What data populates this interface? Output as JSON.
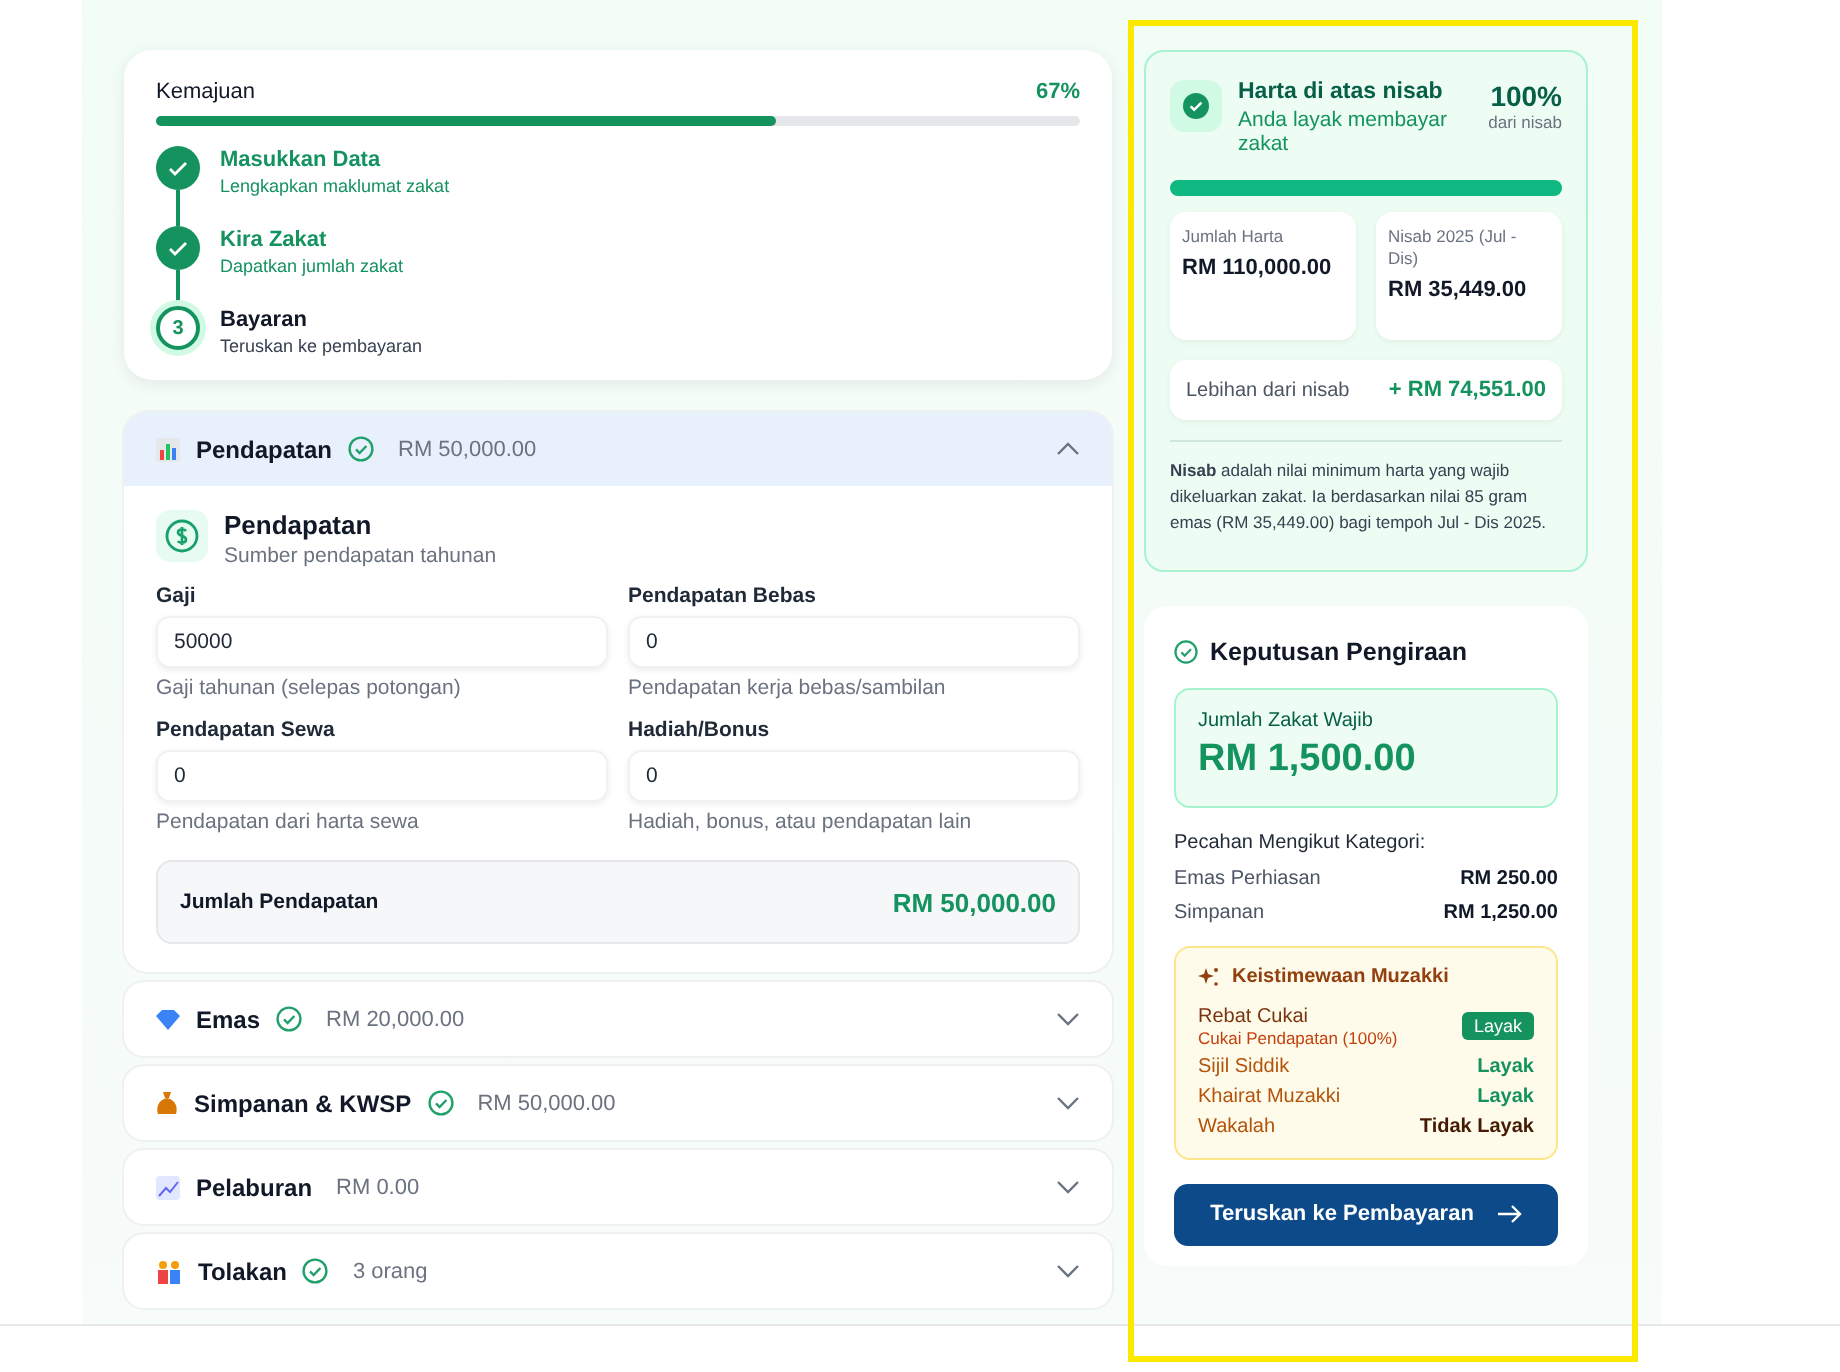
{
  "progress": {
    "label": "Kemajuan",
    "reading": "67%",
    "level": 0.67,
    "steps": [
      {
        "title": "Masukkan Data",
        "subtitle": "Lengkapkan maklumat zakat",
        "complete": true
      },
      {
        "title": "Kira Zakat",
        "subtitle": "Dapatkan jumlah zakat",
        "complete": true
      },
      {
        "marker": "3",
        "title": "Bayaran",
        "subtitle": "Teruskan ke pembayaran",
        "complete": false
      }
    ]
  },
  "sections": [
    {
      "kind": "income",
      "title": "Pendapatan",
      "amount": "RM 50,000.00",
      "complete": true,
      "expanded": true
    },
    {
      "kind": "gold",
      "title": "Emas",
      "amount": "RM 20,000.00",
      "complete": true,
      "expanded": false
    },
    {
      "kind": "savings",
      "title": "Simpanan & KWSP",
      "amount": "RM 50,000.00",
      "complete": true,
      "expanded": false
    },
    {
      "kind": "invest",
      "title": "Pelaburan",
      "amount": "RM 0.00",
      "complete": false,
      "expanded": false
    },
    {
      "kind": "people",
      "title": "Tolakan",
      "amount": "3 orang",
      "complete": true,
      "expanded": false
    }
  ],
  "income_panel": {
    "title": "Pendapatan",
    "subtitle": "Sumber pendapatan tahunan",
    "fields": [
      {
        "label": "Gaji",
        "value": "50000",
        "hint": "Gaji tahunan (selepas potongan)"
      },
      {
        "label": "Pendapatan Bebas",
        "value": "0",
        "hint": "Pendapatan kerja bebas/sambilan"
      },
      {
        "label": "Pendapatan Sewa",
        "value": "0",
        "hint": "Pendapatan dari harta sewa"
      },
      {
        "label": "Hadiah/Bonus",
        "value": "0",
        "hint": "Hadiah, bonus, atau pendapatan lain"
      }
    ],
    "total_label": "Jumlah Pendapatan",
    "total": "RM 50,000.00"
  },
  "nisab": {
    "title": "Harta di atas nisab",
    "subtitle": "Anda layak membayar zakat",
    "percent": "100%",
    "percent_label": "dari nisab",
    "level": 1,
    "stats": [
      {
        "label": "Jumlah Harta",
        "value": "RM 110,000.00"
      },
      {
        "label": "Nisab 2025 (Jul - Dis)",
        "value": "RM 35,449.00"
      }
    ],
    "surplus_label": "Lebihan dari nisab",
    "surplus": "+ RM 74,551.00",
    "note": "**Nisab** adalah nilai minimum harta yang wajib dikeluarkan zakat. Ia berdasarkan nilai 85 gram emas (RM 35,449.00) bagi tempoh Jul - Dis 2025."
  },
  "decision": {
    "title": "Keputusan Pengiraan",
    "due_label": "Jumlah Zakat Wajib",
    "due": "RM 1,500.00",
    "breakdown_title": "Pecahan Mengikut Kategori:",
    "breakdown": [
      {
        "label": "Emas Perhiasan",
        "value": "RM 250.00"
      },
      {
        "label": "Simpanan",
        "value": "RM 1,250.00"
      }
    ],
    "privileges_title": "Keistimewaan Muzakki",
    "privileges": [
      {
        "kind": "badge",
        "name": "Rebat Cukai",
        "detail": "Cukai Pendapatan (100%)",
        "status": "Layak",
        "eligible": true
      },
      {
        "kind": "text",
        "name": "Sijil Siddik",
        "status": "Layak",
        "eligible": true
      },
      {
        "kind": "text",
        "name": "Khairat Muzakki",
        "status": "Layak",
        "eligible": true
      },
      {
        "kind": "text",
        "name": "Wakalah",
        "status": "Tidak Layak",
        "eligible": false
      }
    ],
    "button": "Teruskan ke Pembayaran"
  }
}
